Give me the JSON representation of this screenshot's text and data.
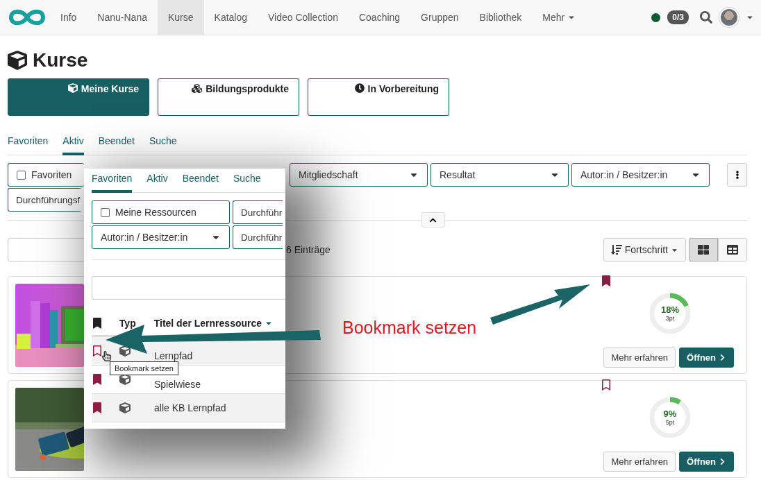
{
  "nav": {
    "items": [
      {
        "label": "Info",
        "selected": false
      },
      {
        "label": "Nanu-Nana",
        "selected": false
      },
      {
        "label": "Kurse",
        "selected": true
      },
      {
        "label": "Katalog",
        "selected": false
      },
      {
        "label": "Video Collection",
        "selected": false
      },
      {
        "label": "Coaching",
        "selected": false
      },
      {
        "label": "Gruppen",
        "selected": false
      },
      {
        "label": "Bibliothek",
        "selected": false
      },
      {
        "label": "Mehr",
        "selected": false,
        "kind": "menu"
      }
    ],
    "badge": "0/3"
  },
  "title": "Kurse",
  "segments": [
    {
      "label": "Meine Kurse",
      "kind": "cube",
      "selected": true
    },
    {
      "label": "Bildungsprodukte",
      "kind": "cubes",
      "selected": false
    },
    {
      "label": "In Vorbereitung",
      "kind": "clock",
      "selected": false
    }
  ],
  "tabs": [
    {
      "label": "Favoriten",
      "selected": false
    },
    {
      "label": "Aktiv",
      "selected": true
    },
    {
      "label": "Beendet",
      "selected": false
    },
    {
      "label": "Suche",
      "selected": false
    }
  ],
  "filters": [
    {
      "kind": "checkbox",
      "label": "Favoriten",
      "checked": false
    },
    {
      "kind": "dropdown",
      "label": "Mitgliedschaft"
    },
    {
      "kind": "dropdown",
      "label": "Resultat"
    },
    {
      "kind": "dropdown",
      "label": "Autor:in / Besitzer:in"
    },
    {
      "kind": "cut",
      "label": "Durchführungsf"
    }
  ],
  "toolbar": {
    "count": "6 Einträge",
    "sort": "Fortschritt",
    "views": [
      {
        "kind": "cards",
        "selected": true
      },
      {
        "kind": "list",
        "selected": false
      }
    ]
  },
  "courses": [
    {
      "bookmarked": true,
      "percent": "18%",
      "points": "3pt",
      "level": 0.18,
      "kind": "devices",
      "buttons": [
        "Mehr erfahren",
        "Öffnen"
      ]
    },
    {
      "bookmarked": false,
      "percent": "9%",
      "points": "5pt",
      "level": 0.09,
      "kind": "frogs",
      "buttons": [
        "Mehr erfahren",
        "Öffnen"
      ]
    }
  ],
  "inset": {
    "tabs": [
      {
        "label": "Favoriten",
        "selected": true
      },
      {
        "label": "Aktiv",
        "selected": false
      },
      {
        "label": "Beendet",
        "selected": false
      },
      {
        "label": "Suche",
        "selected": false
      }
    ],
    "filters": [
      {
        "kind": "checkbox",
        "label": "Meine Ressourcen",
        "checked": false
      },
      {
        "kind": "cut",
        "label": "Durchführ"
      },
      {
        "kind": "dropdown",
        "label": "Autor:in / Besitzer:in"
      },
      {
        "kind": "cut",
        "label": "Durchführ"
      }
    ],
    "columns": [
      "Typ",
      "Titel der Lernressource"
    ],
    "rows": [
      {
        "bookmarked": false,
        "title": "Lernpfad"
      },
      {
        "bookmarked": true,
        "title": "Spielwiese"
      },
      {
        "bookmarked": true,
        "title": "alle KB Lernpfad"
      }
    ],
    "tooltip": "Bookmark setzen"
  },
  "annotation": "Bookmark setzen"
}
